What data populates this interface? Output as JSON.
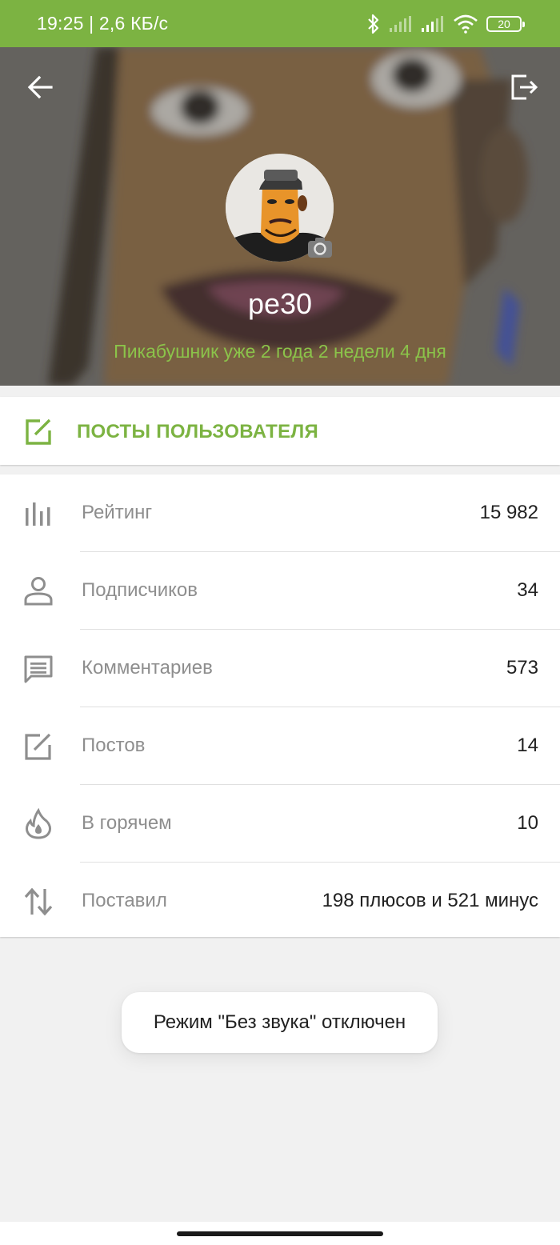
{
  "status_bar": {
    "time_speed": "19:25 | 2,6 КБ/с",
    "battery": "20"
  },
  "profile": {
    "username": "pe30",
    "member_since": "Пикабушник уже 2 года 2 недели 4 дня"
  },
  "posts_button": {
    "label": "ПОСТЫ ПОЛЬЗОВАТЕЛЯ"
  },
  "stats": [
    {
      "label": "Рейтинг",
      "value": "15 982",
      "icon": "bar-chart-icon"
    },
    {
      "label": "Подписчиков",
      "value": "34",
      "icon": "person-icon"
    },
    {
      "label": "Комментариев",
      "value": "573",
      "icon": "comment-icon"
    },
    {
      "label": "Постов",
      "value": "14",
      "icon": "edit-icon"
    },
    {
      "label": "В горячем",
      "value": "10",
      "icon": "flame-icon"
    },
    {
      "label": "Поставил",
      "value": "198 плюсов и 521 минус",
      "icon": "sort-arrows-icon"
    }
  ],
  "toast": {
    "message": "Режим \"Без звука\" отключен"
  },
  "colors": {
    "accent": "#7cb342",
    "member_since": "#8bc34a"
  }
}
